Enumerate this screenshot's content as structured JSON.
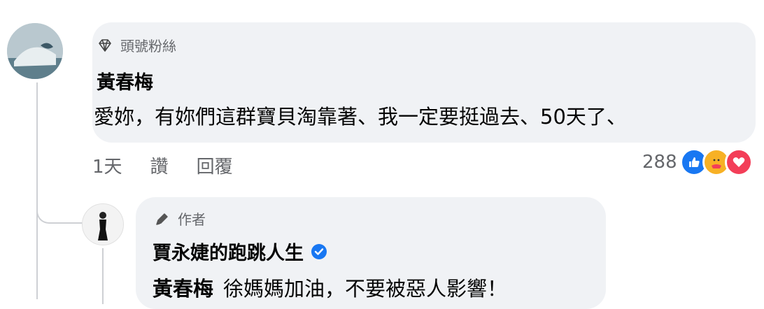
{
  "comment": {
    "badge_label": "頭號粉絲",
    "author": "黃春梅",
    "text": "愛妳，有妳們這群寶貝淘靠著、我一定要挺過去、50天了、",
    "time": "1天",
    "like_label": "讚",
    "reply_label": "回覆",
    "reaction_count": "288",
    "reactions": [
      "like-icon",
      "care-icon",
      "love-icon"
    ]
  },
  "reply": {
    "badge_label": "作者",
    "author": "賈永婕的跑跳人生",
    "mention": "黃春梅",
    "text": "徐媽媽加油，不要被惡人影響！"
  },
  "colors": {
    "bubble": "#f0f2f5",
    "secondary_text": "#65676b",
    "like": "#1877f2",
    "care": "#f7b125",
    "love": "#f33e58"
  }
}
